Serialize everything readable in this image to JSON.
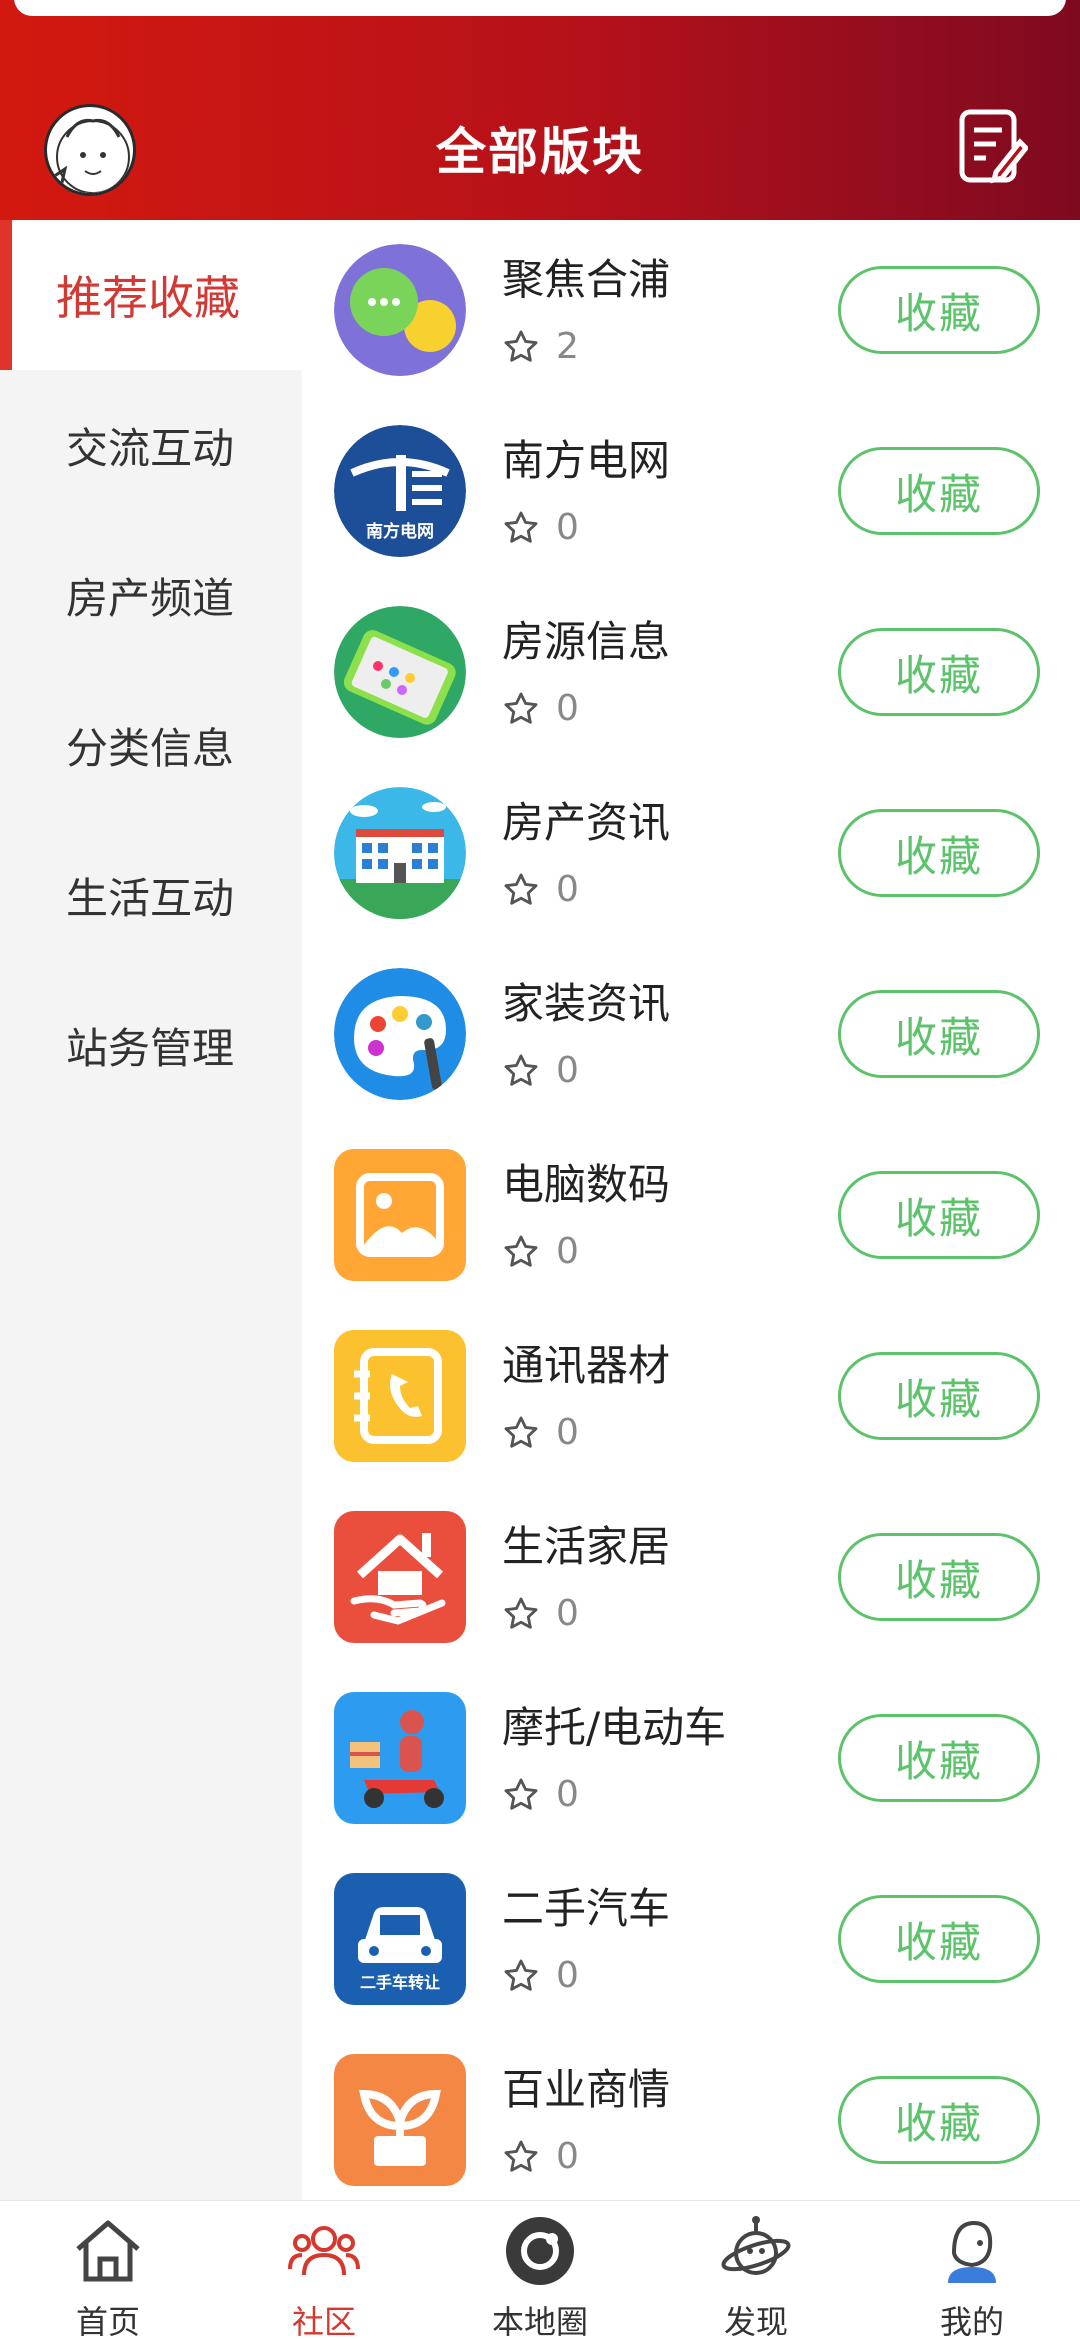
{
  "header": {
    "title": "全部版块",
    "avatar_icon": "cartoon-face-avatar",
    "edit_icon": "edit-note-icon",
    "bg_colors": [
      "#d3190f",
      "#7e0a20"
    ]
  },
  "sidebar": {
    "items": [
      {
        "label": "推荐收藏",
        "active": true
      },
      {
        "label": "交流互动",
        "active": false
      },
      {
        "label": "房产频道",
        "active": false
      },
      {
        "label": "分类信息",
        "active": false
      },
      {
        "label": "生活互动",
        "active": false
      },
      {
        "label": "站务管理",
        "active": false
      }
    ]
  },
  "boards": [
    {
      "title": "聚焦合浦",
      "count": "2",
      "button": "收藏",
      "icon": "chat-bubbles-icon"
    },
    {
      "title": "南方电网",
      "count": "0",
      "button": "收藏",
      "icon": "power-grid-logo-icon",
      "icon_text": "南方电网"
    },
    {
      "title": "房源信息",
      "count": "0",
      "button": "收藏",
      "icon": "phone-apps-icon"
    },
    {
      "title": "房产资讯",
      "count": "0",
      "button": "收藏",
      "icon": "building-icon"
    },
    {
      "title": "家装资讯",
      "count": "0",
      "button": "收藏",
      "icon": "paint-palette-icon"
    },
    {
      "title": "电脑数码",
      "count": "0",
      "button": "收藏",
      "icon": "image-gallery-icon"
    },
    {
      "title": "通讯器材",
      "count": "0",
      "button": "收藏",
      "icon": "phone-book-icon"
    },
    {
      "title": "生活家居",
      "count": "0",
      "button": "收藏",
      "icon": "home-hand-icon"
    },
    {
      "title": "摩托/电动车",
      "count": "0",
      "button": "收藏",
      "icon": "scooter-delivery-icon"
    },
    {
      "title": "二手汽车",
      "count": "0",
      "button": "收藏",
      "icon": "car-icon",
      "icon_text": "二手车转让"
    },
    {
      "title": "百业商情",
      "count": "0",
      "button": "收藏",
      "icon": "plant-pot-icon"
    }
  ],
  "tabbar": {
    "items": [
      {
        "label": "首页",
        "icon": "home-icon",
        "active": false
      },
      {
        "label": "社区",
        "icon": "community-people-icon",
        "active": true
      },
      {
        "label": "本地圈",
        "icon": "local-circle-icon",
        "active": false
      },
      {
        "label": "发现",
        "icon": "planet-discover-icon",
        "active": false
      },
      {
        "label": "我的",
        "icon": "profile-icon",
        "active": false
      }
    ]
  },
  "colors": {
    "accent": "#d6382d",
    "button_green": "#5cc36b",
    "sidebar_bg": "#f4f4f4"
  }
}
